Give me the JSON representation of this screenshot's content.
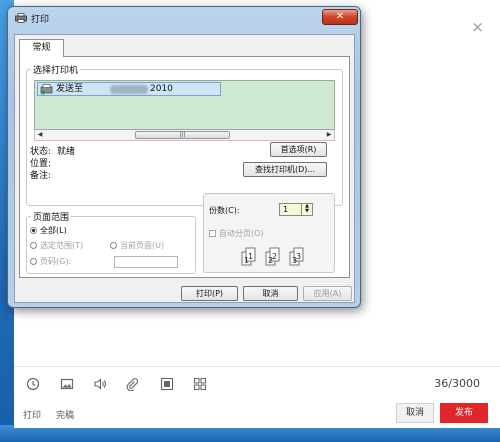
{
  "editor": {
    "close_glyph": "×",
    "counter": "36/3000",
    "footer": {
      "print": "打印",
      "finish": "完稿",
      "cancel": "取消",
      "publish": "发布"
    },
    "toolbar_icons": [
      "clock-icon",
      "image-icon",
      "speaker-icon",
      "attachment-icon",
      "video-icon",
      "grid-icon"
    ]
  },
  "dialog": {
    "title": "打印",
    "close_glyph": "✕",
    "tab_general": "常规",
    "select_printer": {
      "label": "选择打印机",
      "printer_prefix": "发送至",
      "printer_suffix": "2010",
      "scroll_thumb_mark": "|||"
    },
    "status": {
      "status_label": "状态:",
      "status_value": "就绪",
      "location_label": "位置:",
      "comment_label": "备注:"
    },
    "buttons": {
      "preferences": "首选项(R)",
      "find_printer": "查找打印机(D)...",
      "print": "打印(P)",
      "cancel": "取消",
      "apply": "应用(A)"
    },
    "page_range": {
      "label": "页面范围",
      "all": "全部(L)",
      "selection": "选定范围(T)",
      "current_page": "当前页面(U)",
      "pages": "页码(G):"
    },
    "copies": {
      "label": "份数(C):",
      "value": "1",
      "collate": "自动分页(O)",
      "collate_digits": [
        "1",
        "1",
        "2",
        "2",
        "3",
        "3"
      ]
    }
  }
}
